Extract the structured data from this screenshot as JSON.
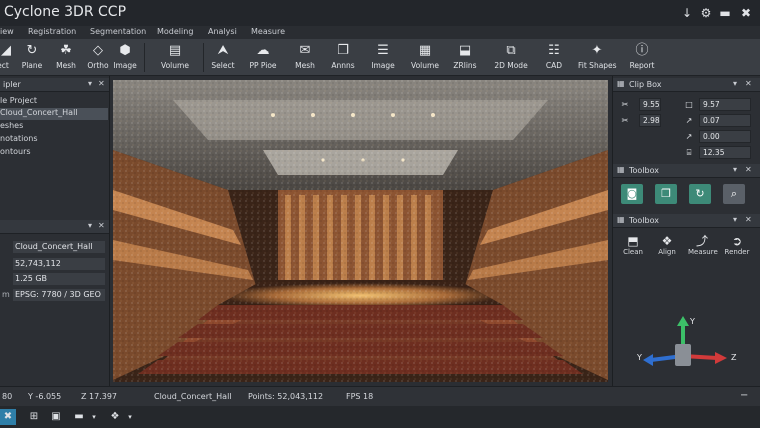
{
  "app": {
    "title": "Cyclone 3DR CCP"
  },
  "menu": [
    "View",
    "Registration",
    "Segmentation",
    "Modeling",
    "Analysi",
    "Measure"
  ],
  "menu_visible": [
    "iew",
    "Registration",
    "Segmentation",
    "Modeling",
    "Analysi",
    "Measure"
  ],
  "ribbon": [
    {
      "label": "ect",
      "icon": "select-icon"
    },
    {
      "label": "Plane",
      "icon": "plane-icon"
    },
    {
      "label": "Mesh",
      "icon": "mesh-icon"
    },
    {
      "label": "Ortho",
      "icon": "ortho-icon"
    },
    {
      "label": "Image",
      "icon": "image-icon"
    },
    {
      "label": "Volume",
      "icon": "volume-icon"
    },
    {
      "label": "Select",
      "icon": "select-cursor-icon"
    },
    {
      "label": "PP Pioe",
      "icon": "pipe-icon"
    },
    {
      "label": "Mesh",
      "icon": "mesh-mail-icon"
    },
    {
      "label": "Annns",
      "icon": "annotations-icon"
    },
    {
      "label": "Image",
      "icon": "image-hierarchy-icon"
    },
    {
      "label": "Volume",
      "icon": "volume-grid-icon"
    },
    {
      "label": "ZRlins",
      "icon": "layers-icon"
    },
    {
      "label": "2D Mode",
      "icon": "2d-mode-icon"
    },
    {
      "label": "CAD",
      "icon": "cad-icon"
    },
    {
      "label": "Fit Shapes",
      "icon": "fit-shapes-icon"
    },
    {
      "label": "Report",
      "icon": "report-icon"
    }
  ],
  "explorer": {
    "title": "ipler",
    "items": [
      "le Project",
      "Cloud_Concert_Hall",
      "eshes",
      "notations",
      "ontours"
    ],
    "selected_index": 1
  },
  "properties": {
    "rows": [
      {
        "key": "",
        "value": "Cloud_Concert_Hall"
      },
      {
        "key": "",
        "value": "52,743,112"
      },
      {
        "key": "",
        "value": "1.25 GB"
      },
      {
        "key": "m",
        "value": "EPSG: 7780 / 3D GEO"
      }
    ]
  },
  "clip_box": {
    "title": "Clip Box",
    "left_values": [
      "9.55",
      "2.98"
    ],
    "right_values": [
      "9.57",
      "0.07",
      "0.00",
      "12.35"
    ]
  },
  "toolbox1": {
    "title": "Toolbox"
  },
  "toolbox2": {
    "title": "Toolbox",
    "buttons": [
      {
        "label": "Clean",
        "icon": "clean-icon"
      },
      {
        "label": "Align",
        "icon": "align-icon"
      },
      {
        "label": "Measure",
        "icon": "measure-icon"
      },
      {
        "label": "Render",
        "icon": "render-icon"
      }
    ]
  },
  "axes": {
    "x": "X",
    "y": "Y",
    "z": "Z",
    "y2": "Y"
  },
  "status": {
    "x": "80",
    "y": "Y -6.055",
    "z": "Z 17.397",
    "cloud": "Cloud_Concert_Hall",
    "points": "Points: 52,043,112",
    "fps": "FPS  18"
  }
}
